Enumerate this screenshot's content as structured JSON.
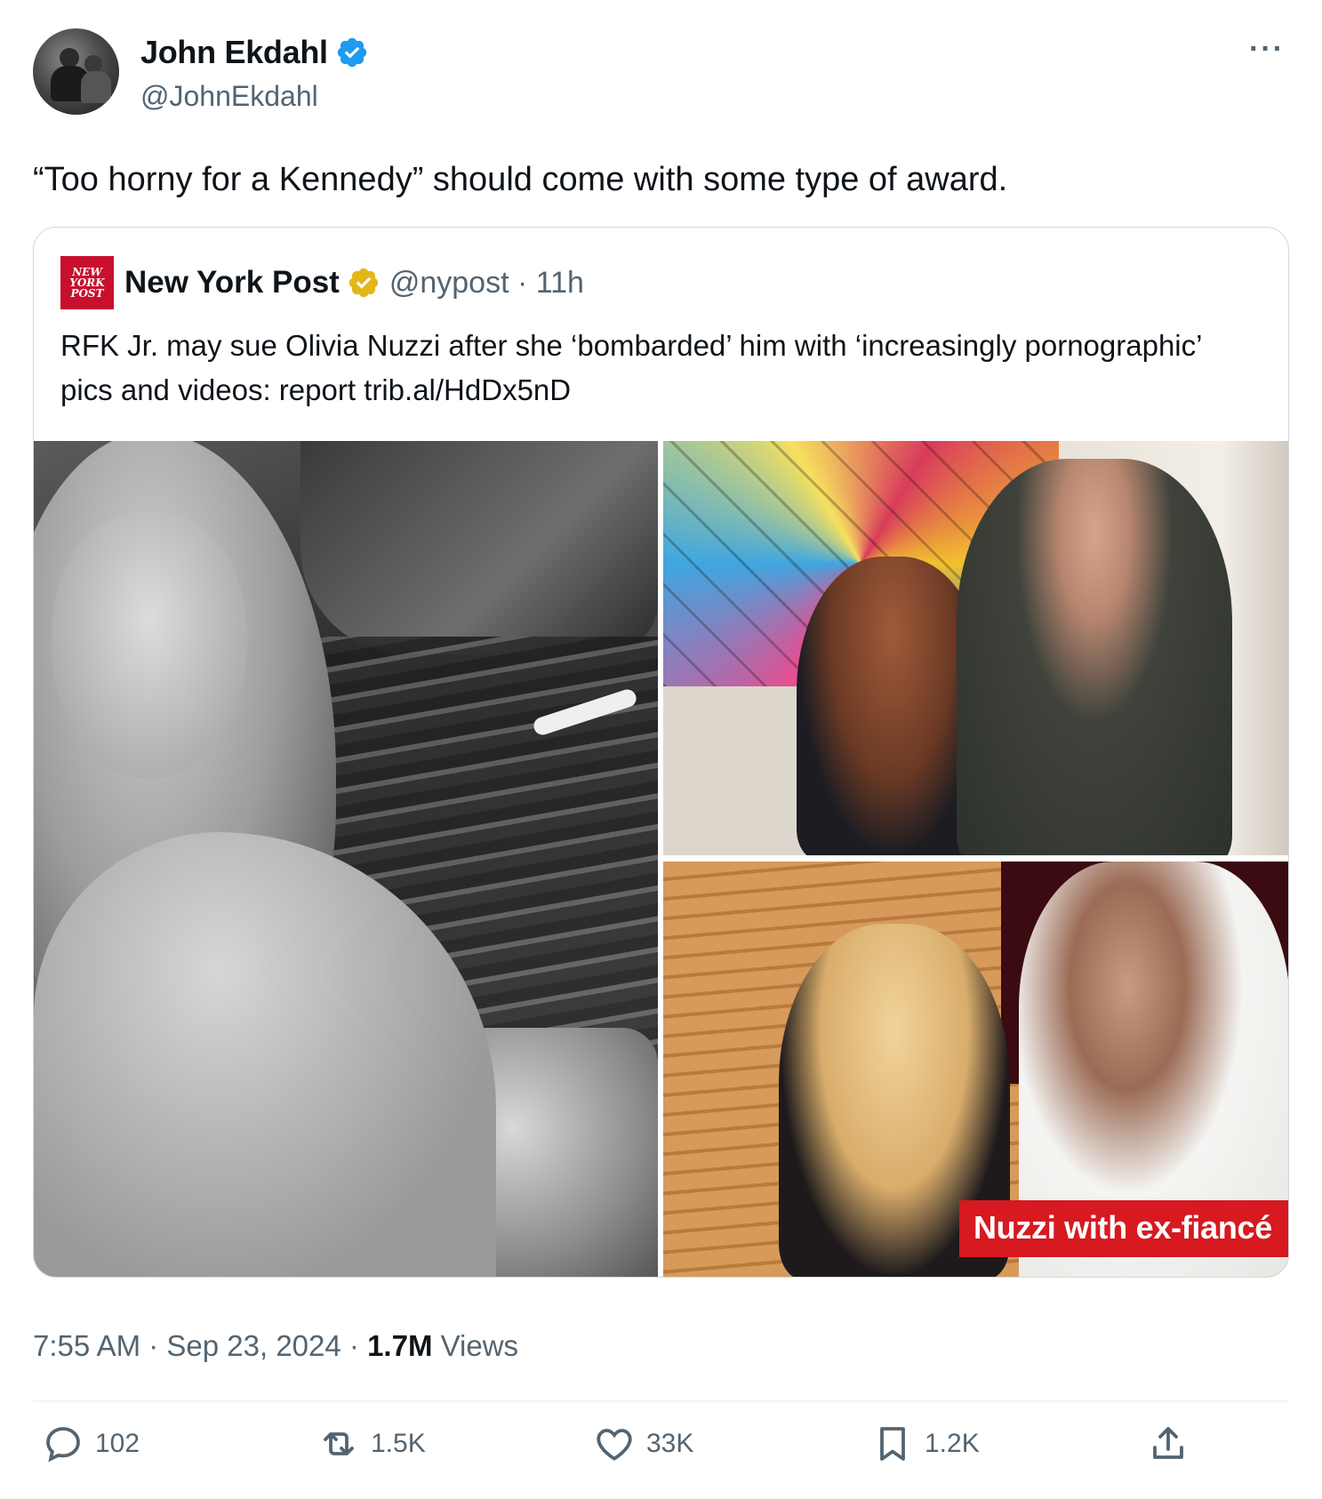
{
  "author": {
    "display_name": "John Ekdahl",
    "handle": "@JohnEkdahl",
    "verified_color": "#1d9bf0"
  },
  "tweet": {
    "text": "“Too horny for a Kennedy” should come with some type of award."
  },
  "quote": {
    "logo_text": [
      "NEW",
      "YORK",
      "POST"
    ],
    "display_name": "New York Post",
    "handle_time": "@nypost · 11h",
    "verified_color": "#e2b719",
    "text": "RFK Jr. may sue Olivia Nuzzi after she ‘bombarded’ him with ‘increasingly pornographic’ pics and videos: report trib.al/HdDx5nD",
    "caption": "Nuzzi with ex-fiancé",
    "caption_color": "#d71920"
  },
  "meta": {
    "time_date": "7:55 AM · Sep 23, 2024 · ",
    "views_count": "1.7M",
    "views_label": " Views"
  },
  "actions": {
    "replies": "102",
    "reposts": "1.5K",
    "likes": "33K",
    "bookmarks": "1.2K"
  },
  "icons": [
    "more-icon",
    "reply-icon",
    "repost-icon",
    "like-icon",
    "bookmark-icon",
    "share-icon",
    "verified-icon"
  ]
}
